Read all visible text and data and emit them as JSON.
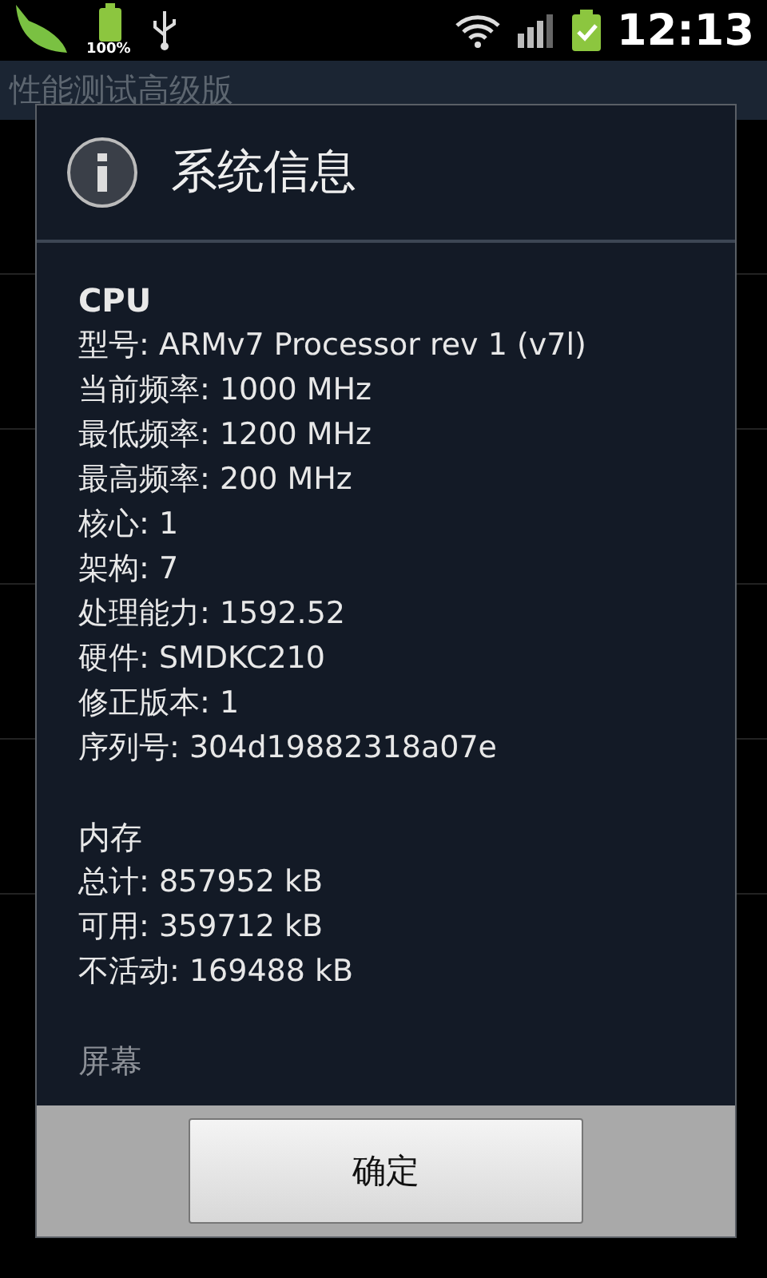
{
  "status_bar": {
    "battery_percent": "100%",
    "time": "12:13"
  },
  "app_title": "性能测试高级版",
  "dialog": {
    "title": "系统信息",
    "sections": [
      {
        "title": "CPU",
        "lines": [
          "型号: ARMv7 Processor rev 1 (v7l)",
          "当前频率: 1000 MHz",
          "最低频率: 1200 MHz",
          "最高频率: 200 MHz",
          "核心: 1",
          "架构: 7",
          "处理能力: 1592.52",
          "硬件: SMDKC210",
          "修正版本: 1",
          "序列号: 304d19882318a07e"
        ]
      },
      {
        "title": "内存",
        "lines": [
          "总计: 857952 kB",
          "可用: 359712 kB",
          "不活动: 169488 kB"
        ]
      },
      {
        "title": "屏幕"
      }
    ],
    "button": "确定"
  }
}
